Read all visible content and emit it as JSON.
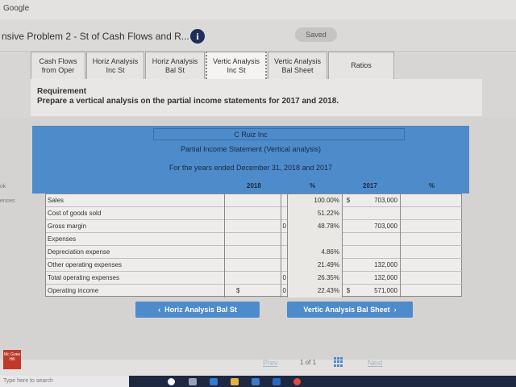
{
  "browser": {
    "label": "Google"
  },
  "header": {
    "title": "nsive Problem 2 - St of Cash Flows and R...",
    "saved": "Saved"
  },
  "tabs": [
    {
      "line1": "Cash Flows",
      "line2": "from Oper"
    },
    {
      "line1": "Horiz Analysis",
      "line2": "Inc St"
    },
    {
      "line1": "Horiz Analysis",
      "line2": "Bal St"
    },
    {
      "line1": "Vertic Analysis",
      "line2": "Inc St"
    },
    {
      "line1": "Vertic Analysis",
      "line2": "Bal Sheet"
    },
    {
      "line1": "Ratios",
      "line2": ""
    }
  ],
  "requirement": {
    "heading": "Requirement",
    "text": "Prepare a vertical analysis on the partial income statements for 2017 and 2018."
  },
  "statement": {
    "company": "C Ruiz Inc",
    "title": "Partial Income Statement (Vertical analysis)",
    "period": "For the years ended December 31, 2018 and 2017",
    "col_2018": "2018",
    "col_pct": "%",
    "col_2017": "2017",
    "col_pct2": "%"
  },
  "rows": [
    {
      "label": "Sales",
      "d18": "",
      "zero": "",
      "pct18": "100.00%",
      "d17": "$",
      "v17": "703,000"
    },
    {
      "label": "Cost of goods sold",
      "d18": "",
      "zero": "",
      "pct18": "51.22%",
      "d17": "",
      "v17": ""
    },
    {
      "label": "Gross margin",
      "d18": "",
      "zero": "0",
      "pct18": "48.78%",
      "d17": "",
      "v17": "703,000"
    },
    {
      "label": "Expenses",
      "d18": "",
      "zero": "",
      "pct18": "",
      "d17": "",
      "v17": ""
    },
    {
      "label": "Depreciation expense",
      "d18": "",
      "zero": "",
      "pct18": "4.86%",
      "d17": "",
      "v17": ""
    },
    {
      "label": "Other operating expenses",
      "d18": "",
      "zero": "",
      "pct18": "21.49%",
      "d17": "",
      "v17": "132,000"
    },
    {
      "label": "Total operating expenses",
      "d18": "",
      "zero": "0",
      "pct18": "26.35%",
      "d17": "",
      "v17": "132,000"
    },
    {
      "label": "Operating income",
      "d18": "$",
      "zero": "0",
      "pct18": "22.43%",
      "d17": "$",
      "v17": "571,000"
    }
  ],
  "nav": {
    "prev_button": "Horiz Analysis Bal St",
    "next_button": "Vertic Analysis Bal Sheet",
    "prev": "Prev",
    "page": "1 of 1",
    "next": "Next"
  },
  "side": {
    "ok": "ok",
    "ences": "ences"
  },
  "logo": {
    "text": "Mc Graw Hill"
  },
  "taskbar": {
    "search": "Type here to search"
  },
  "colors": {
    "accent": "#4e8bcb",
    "info": "#1e2d5a"
  }
}
